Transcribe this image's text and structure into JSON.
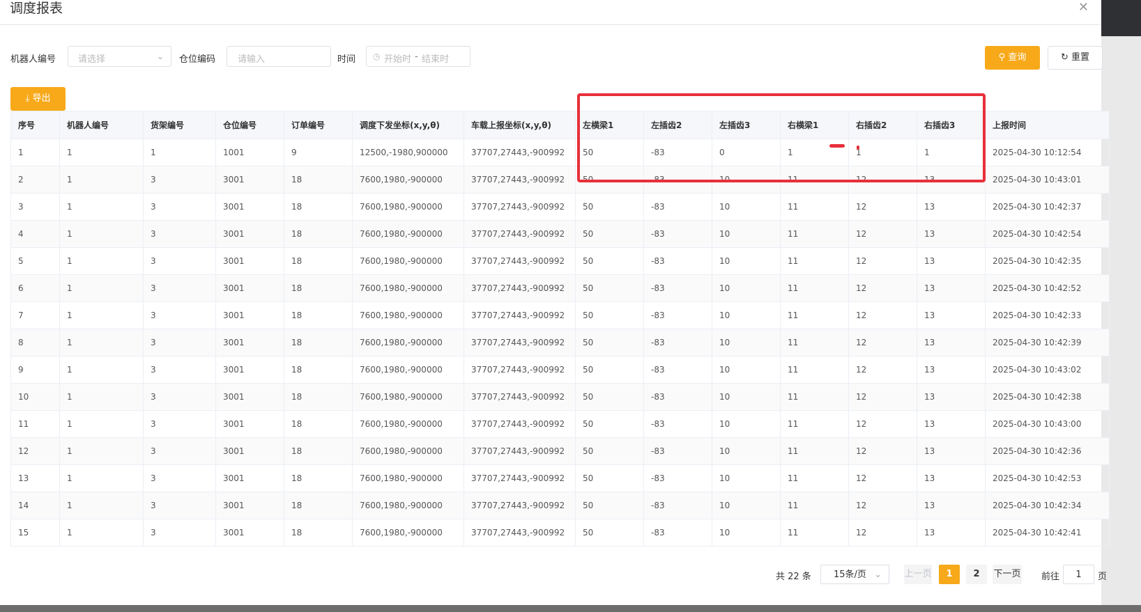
{
  "dialog": {
    "title": "调度报表"
  },
  "filters": {
    "robot_label": "机器人编号",
    "robot_placeholder": "请选择",
    "location_label": "仓位编码",
    "location_placeholder": "请输入",
    "time_label": "时间",
    "time_start": "开始时",
    "time_sep": "-",
    "time_end": "结束时"
  },
  "buttons": {
    "query": "查询",
    "reset": "重置",
    "export": "导出"
  },
  "table": {
    "headers": [
      "序号",
      "机器人编号",
      "货架编号",
      "仓位编号",
      "订单编号",
      "调度下发坐标(x,y,θ)",
      "车载上报坐标(x,y,θ)",
      "左横梁1",
      "左插齿2",
      "左插齿3",
      "右横梁1",
      "右插齿2",
      "右插齿3",
      "上报时间"
    ],
    "rows": [
      [
        "1",
        "1",
        "1",
        "1001",
        "9",
        "12500,-1980,900000",
        "37707,27443,-900992",
        "50",
        "-83",
        "0",
        "1",
        "1",
        "1",
        "2025-04-30 10:12:54"
      ],
      [
        "2",
        "1",
        "3",
        "3001",
        "18",
        "7600,1980,-900000",
        "37707,27443,-900992",
        "50",
        "-83",
        "10",
        "11",
        "12",
        "13",
        "2025-04-30 10:43:01"
      ],
      [
        "3",
        "1",
        "3",
        "3001",
        "18",
        "7600,1980,-900000",
        "37707,27443,-900992",
        "50",
        "-83",
        "10",
        "11",
        "12",
        "13",
        "2025-04-30 10:42:37"
      ],
      [
        "4",
        "1",
        "3",
        "3001",
        "18",
        "7600,1980,-900000",
        "37707,27443,-900992",
        "50",
        "-83",
        "10",
        "11",
        "12",
        "13",
        "2025-04-30 10:42:54"
      ],
      [
        "5",
        "1",
        "3",
        "3001",
        "18",
        "7600,1980,-900000",
        "37707,27443,-900992",
        "50",
        "-83",
        "10",
        "11",
        "12",
        "13",
        "2025-04-30 10:42:35"
      ],
      [
        "6",
        "1",
        "3",
        "3001",
        "18",
        "7600,1980,-900000",
        "37707,27443,-900992",
        "50",
        "-83",
        "10",
        "11",
        "12",
        "13",
        "2025-04-30 10:42:52"
      ],
      [
        "7",
        "1",
        "3",
        "3001",
        "18",
        "7600,1980,-900000",
        "37707,27443,-900992",
        "50",
        "-83",
        "10",
        "11",
        "12",
        "13",
        "2025-04-30 10:42:33"
      ],
      [
        "8",
        "1",
        "3",
        "3001",
        "18",
        "7600,1980,-900000",
        "37707,27443,-900992",
        "50",
        "-83",
        "10",
        "11",
        "12",
        "13",
        "2025-04-30 10:42:39"
      ],
      [
        "9",
        "1",
        "3",
        "3001",
        "18",
        "7600,1980,-900000",
        "37707,27443,-900992",
        "50",
        "-83",
        "10",
        "11",
        "12",
        "13",
        "2025-04-30 10:43:02"
      ],
      [
        "10",
        "1",
        "3",
        "3001",
        "18",
        "7600,1980,-900000",
        "37707,27443,-900992",
        "50",
        "-83",
        "10",
        "11",
        "12",
        "13",
        "2025-04-30 10:42:38"
      ],
      [
        "11",
        "1",
        "3",
        "3001",
        "18",
        "7600,1980,-900000",
        "37707,27443,-900992",
        "50",
        "-83",
        "10",
        "11",
        "12",
        "13",
        "2025-04-30 10:43:00"
      ],
      [
        "12",
        "1",
        "3",
        "3001",
        "18",
        "7600,1980,-900000",
        "37707,27443,-900992",
        "50",
        "-83",
        "10",
        "11",
        "12",
        "13",
        "2025-04-30 10:42:36"
      ],
      [
        "13",
        "1",
        "3",
        "3001",
        "18",
        "7600,1980,-900000",
        "37707,27443,-900992",
        "50",
        "-83",
        "10",
        "11",
        "12",
        "13",
        "2025-04-30 10:42:53"
      ],
      [
        "14",
        "1",
        "3",
        "3001",
        "18",
        "7600,1980,-900000",
        "37707,27443,-900992",
        "50",
        "-83",
        "10",
        "11",
        "12",
        "13",
        "2025-04-30 10:42:34"
      ],
      [
        "15",
        "1",
        "3",
        "3001",
        "18",
        "7600,1980,-900000",
        "37707,27443,-900992",
        "50",
        "-83",
        "10",
        "11",
        "12",
        "13",
        "2025-04-30 10:42:41"
      ]
    ]
  },
  "pagination": {
    "total": "共 22 条",
    "page_size": "15条/页",
    "prev": "上一页",
    "pages": [
      "1",
      "2"
    ],
    "current": "1",
    "next": "下一页",
    "goto_label": "前往",
    "goto_value": "1",
    "goto_suffix": "页"
  },
  "colors": {
    "accent": "#f7a91a",
    "annotation": "#e8303a"
  }
}
